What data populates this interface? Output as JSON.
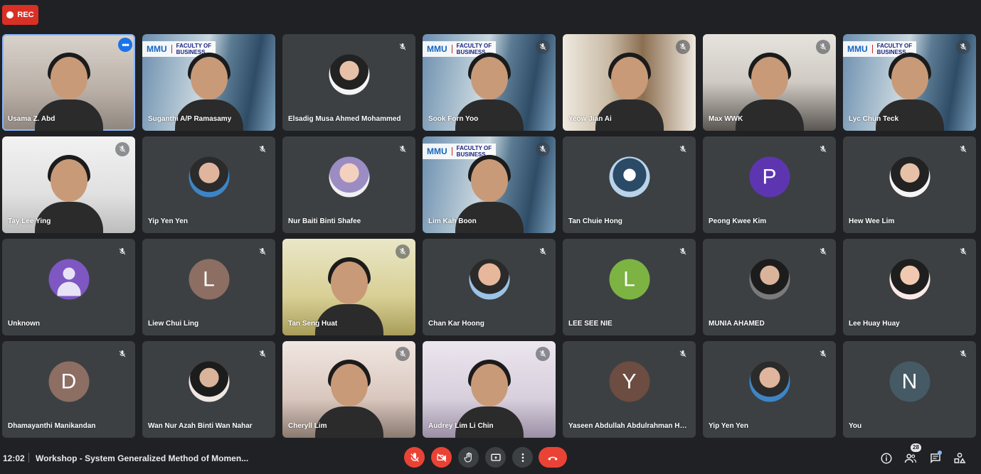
{
  "recording": {
    "label": "REC"
  },
  "participants": [
    {
      "name": "Usama Z. Abd",
      "kind": "video",
      "bg": "home",
      "muted": false,
      "active": true,
      "more": true
    },
    {
      "name": "Suganthi A/P Ramasamy",
      "kind": "video",
      "bg": "building",
      "muted": false,
      "logo": true
    },
    {
      "name": "Elsadig Musa Ahmed Mohammed",
      "kind": "avatar",
      "avatar": "photo e",
      "muted": true
    },
    {
      "name": "Sook Forn Yoo",
      "kind": "video",
      "bg": "building",
      "muted": true,
      "logo": true
    },
    {
      "name": "Yeow Jian Ai",
      "kind": "video",
      "bg": "books",
      "muted": true
    },
    {
      "name": "Max WWK",
      "kind": "video",
      "bg": "office",
      "muted": true
    },
    {
      "name": "Lyc Chun Teck",
      "kind": "video",
      "bg": "building",
      "muted": true,
      "logo": true
    },
    {
      "name": "Tay Lee Ying",
      "kind": "video",
      "bg": "plain",
      "muted": true
    },
    {
      "name": "Yip Yen Yen",
      "kind": "avatar",
      "avatar": "photo c",
      "muted": true
    },
    {
      "name": "Nur Baiti Binti Shafee",
      "kind": "avatar",
      "avatar": "photo b",
      "muted": true
    },
    {
      "name": "Lim Kah Boon",
      "kind": "video",
      "bg": "building",
      "muted": true,
      "logo": true
    },
    {
      "name": "Tan Chuie Hong",
      "kind": "avatar",
      "avatar": "photo d",
      "muted": true
    },
    {
      "name": "Peong Kwee Kim",
      "kind": "avatar",
      "letter": "P",
      "color": "#5e35b1",
      "muted": true
    },
    {
      "name": "Hew Wee Lim",
      "kind": "avatar",
      "avatar": "photo e",
      "muted": true
    },
    {
      "name": "Unknown",
      "kind": "unknown",
      "muted": true
    },
    {
      "name": "Liew Chui Ling",
      "kind": "avatar",
      "letter": "L",
      "color": "#8d6e63",
      "muted": true
    },
    {
      "name": "Tan Seng Huat",
      "kind": "video",
      "bg": "yellow",
      "muted": true
    },
    {
      "name": "Chan Kar Hoong",
      "kind": "avatar",
      "avatar": "photo a",
      "muted": true
    },
    {
      "name": "LEE SEE NIE",
      "kind": "avatar",
      "letter": "L",
      "color": "#7cb342",
      "muted": true
    },
    {
      "name": "MUNIA AHAMED",
      "kind": "avatar",
      "avatar": "photo h",
      "muted": true
    },
    {
      "name": "Lee Huay Huay",
      "kind": "avatar",
      "avatar": "photo f",
      "muted": true
    },
    {
      "name": "Dhamayanthi Manikandan",
      "kind": "avatar",
      "letter": "D",
      "color": "#8d6e63",
      "muted": true
    },
    {
      "name": "Wan Nur Azah Binti Wan Nahar",
      "kind": "avatar",
      "avatar": "photo g",
      "muted": true
    },
    {
      "name": "Cheryll Lim",
      "kind": "video",
      "bg": "dim",
      "muted": true
    },
    {
      "name": "Audrey Lim Li Chin",
      "kind": "video",
      "bg": "purple",
      "muted": true
    },
    {
      "name": "Yaseen Abdullah Abdulrahman He...",
      "kind": "avatar",
      "letter": "Y",
      "color": "#6d4c41",
      "muted": true
    },
    {
      "name": "Yip Yen Yen",
      "kind": "avatar",
      "avatar": "photo c",
      "muted": true
    },
    {
      "name": "You",
      "kind": "avatar",
      "letter": "N",
      "color": "#455a64",
      "muted": true
    }
  ],
  "bottom_bar": {
    "time": "12:02",
    "title": "Workshop - System Generalized Method of Momen...",
    "participant_count": "28"
  },
  "colors": {
    "red": "#ea4335",
    "bg": "#202124",
    "tile": "#3c4043",
    "accent": "#8ab4f8"
  }
}
